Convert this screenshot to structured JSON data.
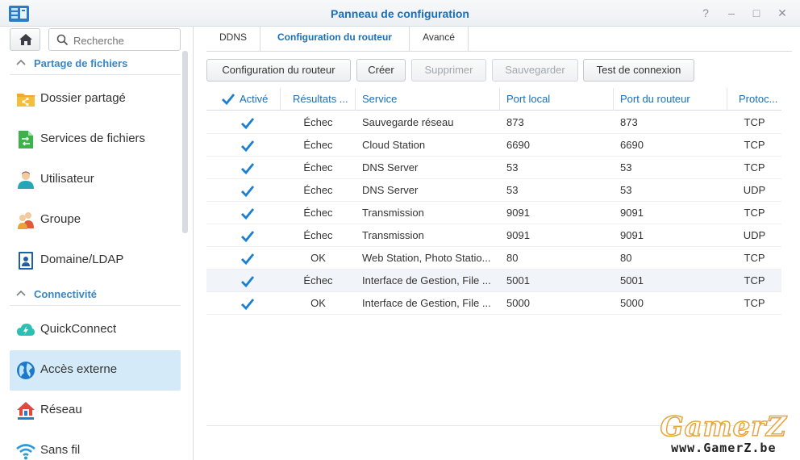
{
  "window": {
    "title": "Panneau de configuration",
    "help": "?",
    "minimize": "–",
    "maximize": "□",
    "close": "✕"
  },
  "sidebar": {
    "search_placeholder": "Recherche",
    "sections": [
      {
        "label": "Partage de fichiers"
      },
      {
        "label": "Connectivité"
      }
    ],
    "items": [
      {
        "label": "Dossier partagé",
        "icon": "folder-share-icon"
      },
      {
        "label": "Services de fichiers",
        "icon": "file-services-icon"
      },
      {
        "label": "Utilisateur",
        "icon": "user-icon"
      },
      {
        "label": "Groupe",
        "icon": "group-icon"
      },
      {
        "label": "Domaine/LDAP",
        "icon": "domain-icon"
      },
      {
        "label": "QuickConnect",
        "icon": "quickconnect-icon"
      },
      {
        "label": "Accès externe",
        "icon": "globe-icon",
        "active": true
      },
      {
        "label": "Réseau",
        "icon": "house-network-icon"
      },
      {
        "label": "Sans fil",
        "icon": "wifi-icon"
      }
    ]
  },
  "tabs": [
    {
      "label": "DDNS"
    },
    {
      "label": "Configuration du routeur",
      "active": true
    },
    {
      "label": "Avancé"
    }
  ],
  "toolbar": [
    {
      "label": "Configuration du routeur",
      "enabled": true
    },
    {
      "label": "Créer",
      "enabled": true
    },
    {
      "label": "Supprimer",
      "enabled": false
    },
    {
      "label": "Sauvegarder",
      "enabled": false
    },
    {
      "label": "Test de connexion",
      "enabled": true
    }
  ],
  "grid": {
    "columns": [
      "Activé",
      "Résultats ...",
      "Service",
      "Port local",
      "Port du routeur",
      "Protoc..."
    ],
    "rows": [
      {
        "enabled": true,
        "result": "Échec",
        "service": "Sauvegarde réseau",
        "local_port": "873",
        "router_port": "873",
        "protocol": "TCP"
      },
      {
        "enabled": true,
        "result": "Échec",
        "service": "Cloud Station",
        "local_port": "6690",
        "router_port": "6690",
        "protocol": "TCP"
      },
      {
        "enabled": true,
        "result": "Échec",
        "service": "DNS Server",
        "local_port": "53",
        "router_port": "53",
        "protocol": "TCP"
      },
      {
        "enabled": true,
        "result": "Échec",
        "service": "DNS Server",
        "local_port": "53",
        "router_port": "53",
        "protocol": "UDP"
      },
      {
        "enabled": true,
        "result": "Échec",
        "service": "Transmission",
        "local_port": "9091",
        "router_port": "9091",
        "protocol": "TCP"
      },
      {
        "enabled": true,
        "result": "Échec",
        "service": "Transmission",
        "local_port": "9091",
        "router_port": "9091",
        "protocol": "UDP"
      },
      {
        "enabled": true,
        "result": "OK",
        "service": "Web Station, Photo Statio...",
        "local_port": "80",
        "router_port": "80",
        "protocol": "TCP"
      },
      {
        "enabled": true,
        "result": "Échec",
        "service": "Interface de Gestion, File ...",
        "local_port": "5001",
        "router_port": "5001",
        "protocol": "TCP"
      },
      {
        "enabled": true,
        "result": "OK",
        "service": "Interface de Gestion, File ...",
        "local_port": "5000",
        "router_port": "5000",
        "protocol": "TCP"
      }
    ]
  },
  "watermark": {
    "logo": "GamerZ",
    "url": "www.GamerZ.be"
  },
  "colors": {
    "accent": "#1a6fb8",
    "section": "#3a86c4",
    "active_bg": "#d5eaf8",
    "check": "#1a7fd4"
  }
}
